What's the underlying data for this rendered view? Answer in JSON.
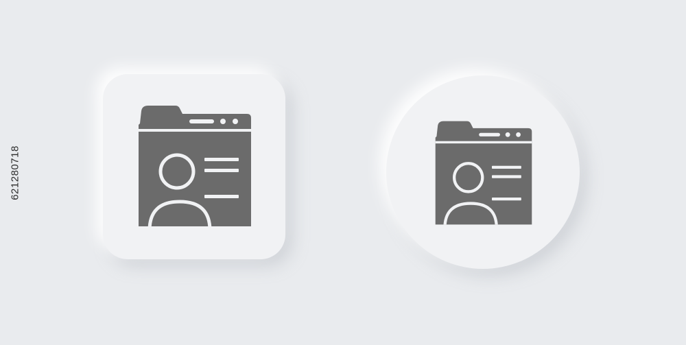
{
  "stock_id": "621280718",
  "colors": {
    "background": "#e9ebee",
    "tile": "#f1f2f4",
    "icon": "#6b6b6b",
    "icon_detail": "#f1f2f4"
  },
  "icons": [
    "profile-browser-window-icon",
    "profile-browser-window-icon"
  ]
}
